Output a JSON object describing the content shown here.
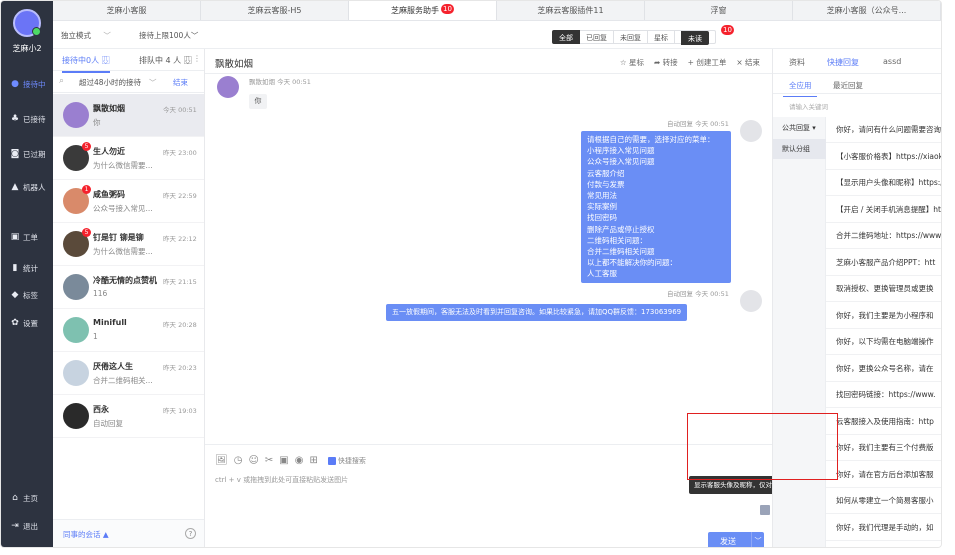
{
  "rail": {
    "brand": "芝麻小2",
    "items": [
      {
        "label": "接待中",
        "icon": "chat-icon",
        "active": true
      },
      {
        "label": "已接待",
        "icon": "thumb-icon"
      },
      {
        "label": "已过期",
        "icon": "clock-icon"
      },
      {
        "label": "机器人",
        "icon": "robot-icon"
      },
      {
        "label": "工单",
        "icon": "ticket-icon"
      },
      {
        "label": "统计",
        "icon": "stats-icon"
      },
      {
        "label": "标签",
        "icon": "tag-icon"
      },
      {
        "label": "设置",
        "icon": "gear-icon"
      }
    ],
    "home": "主页",
    "logout": "退出"
  },
  "tabs": [
    {
      "label": "芝麻小客服"
    },
    {
      "label": "芝麻云客服-H5"
    },
    {
      "label": "芝麻服务助手",
      "badge": "10",
      "active": true
    },
    {
      "label": "芝麻云客服插件11"
    },
    {
      "label": "浮窗"
    },
    {
      "label": "芝麻小客服（公众号..."
    }
  ],
  "filters": {
    "mode": "独立模式",
    "mode_arrow": "﹀",
    "sort": "接待上限100人﹀",
    "segments": [
      "全部",
      "已回复",
      "未回复",
      "星标",
      "未读"
    ],
    "unread_badge": "10"
  },
  "sessions": {
    "tab_active": "接待中0人 ⇩⃞",
    "tab_queue": "排队中 4 人 ⇩⃞",
    "more": "⋮",
    "search_value": "超过48小时的接待",
    "search_dd": "﹀",
    "end_label": "结束",
    "items": [
      {
        "name": "飘散如烟",
        "time": "今天 00:51",
        "preview": "你",
        "active": true,
        "color": "#9a7fd0"
      },
      {
        "name": "生人勿近",
        "time": "昨天 23:00",
        "preview": "为什么微信需要...",
        "badge": "5",
        "color": "#3a3a3a"
      },
      {
        "name": "咸鱼粥码",
        "time": "昨天 22:59",
        "preview": "公众号接入常见...",
        "badge": "1",
        "color": "#d98a6a"
      },
      {
        "name": "钉是钉 铆是铆",
        "time": "昨天 22:12",
        "preview": "为什么微信需要...",
        "badge": "5",
        "color": "#5a4a3a"
      },
      {
        "name": "冷酷无情的点赞机",
        "time": "昨天 21:15",
        "preview": "116",
        "color": "#7a8a9a"
      },
      {
        "name": "Minifull",
        "time": "昨天 20:28",
        "preview": "1",
        "color": "#7ec1b0"
      },
      {
        "name": "厌倦这人生",
        "time": "昨天 20:23",
        "preview": "合并二维码相关...",
        "color": "#c7d3e0"
      },
      {
        "name": "西永",
        "time": "昨天 19:03",
        "preview": "自动回复",
        "color": "#2a2a2a"
      }
    ],
    "footer": "同事的会话 ▲",
    "help": "?"
  },
  "chat": {
    "title": "飘散如烟",
    "actions": [
      "☆ 星标",
      "➦ 转接",
      "+ 创建工单",
      "× 结束"
    ],
    "incoming": {
      "meta": "飘散如烟  今天 00:51",
      "text": "你"
    },
    "auto1_meta": "自动回复  今天 00:51",
    "menu_lines": [
      "请根据自己的需要，选择对应的菜单：",
      "小程序接入常见问题",
      "公众号接入常见问题",
      "云客服介绍",
      "付款与发票",
      "常见用法",
      "实际案例",
      "找回密码",
      "删除产品或停止授权",
      "二维码相关问题：",
      "合并二维码相关问题",
      "以上都不能解决你的问题：",
      "人工客服"
    ],
    "auto2_meta": "自动回复  今天 00:51",
    "holiday": "五一放假期间，客服无法及时看到并回复咨询。如果比较紧急，请加QQ群反馈：173063969",
    "tools": [
      "🖼",
      "◷",
      "☺",
      "✂",
      "▣",
      "◉",
      "⊞"
    ],
    "quick_search": "快捷搜索",
    "hint": "ctrl + v 或拖拽到此处可直接粘贴发送图片",
    "send": "发送",
    "send_dd": "﹀",
    "tooltip": "显示客服头像及昵称，仅对当前产品有效。"
  },
  "right": {
    "tabs": [
      "资料",
      "快捷回复",
      "assd"
    ],
    "sub": [
      "全应用",
      "最近回复"
    ],
    "search_placeholder": "请输入关键词",
    "cat_label": "公共回复 ▾",
    "cat_selected": "默认分组",
    "items": [
      "你好，请问有什么问题需要咨询吗",
      "【小客服价格表】https://xiaokefu",
      "【显示用户头像和昵称】https://",
      "【开启 / 关闭手机消息提醒】ht",
      "合并二维码地址：https://www.",
      "芝麻小客服产品介绍PPT：htt",
      "取消授权、更换管理员或更换",
      "你好，我们主要是为小程序和",
      "你好，以下均需在电脑端操作",
      "你好，更换公众号名称，请在",
      "找回密码链接：https://www.",
      "云客服接入及使用指南：http",
      "你好，我们主要有三个付费版",
      "你好，请在官方后台添加客服",
      "如何从零建立一个简易客服小",
      "你好，我们代理是手动的，如",
      "如果需要更换微信，请前往公"
    ]
  }
}
